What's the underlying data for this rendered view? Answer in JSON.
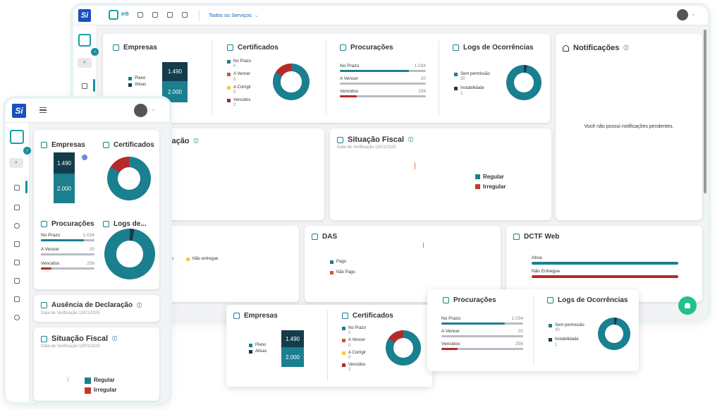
{
  "brand": {
    "logo_text": "Si",
    "secondary_logo_text": "Iri5"
  },
  "header": {
    "services_dropdown": "Todos os Serviços"
  },
  "empresas": {
    "title": "Empresas",
    "legend": [
      "Plano",
      "Ativas"
    ],
    "plano_value": "1.490",
    "ativas_value": "2.000"
  },
  "certificados": {
    "title": "Certificados",
    "legend": [
      {
        "label": "No Prazo",
        "count": "0",
        "color": "#1a7f8f"
      },
      {
        "label": "A Vencer",
        "count": "0",
        "color": "#d2592e"
      },
      {
        "label": "A Corrigir",
        "count": "0",
        "color": "#f2c94c"
      },
      {
        "label": "Vencidos",
        "count": "2",
        "color": "#a52a2a"
      }
    ]
  },
  "procuracoes": {
    "title": "Procurações",
    "rows": [
      {
        "label": "No Prazo",
        "value": "1.034",
        "fill": 0.8,
        "color": "#1a7f8f"
      },
      {
        "label": "A Vencer",
        "value": "20",
        "fill": 0.0,
        "color": "#1a7f8f"
      },
      {
        "label": "Vencidos",
        "value": "256",
        "fill": 0.2,
        "color": "#b52a2a"
      }
    ]
  },
  "logs": {
    "title": "Logs de Ocorrências",
    "title_short": "Logs de...",
    "legend": [
      {
        "label": "Sem permissão",
        "count": "30"
      },
      {
        "label": "Instabilidade",
        "count": "1"
      }
    ]
  },
  "notificacoes": {
    "title": "Notificações",
    "empty": "Você não possui notificações pendentes."
  },
  "ausencia": {
    "title": "Ausência de Declaração",
    "title_partial": "laração",
    "date": "Data de Verificação 13/01/2025"
  },
  "situacao": {
    "title": "Situação Fiscal",
    "date": "Data de Verificação 13/01/2025",
    "legend": [
      "Regular",
      "Irregular"
    ]
  },
  "dctf_row": {
    "left_partial": "mitido",
    "left_nao_entregue": "Não entregue"
  },
  "das": {
    "title": "DAS",
    "legend": [
      "Pago",
      "Não Pago"
    ]
  },
  "dctf_web": {
    "title": "DCTF Web",
    "rows": [
      "Ativa",
      "Não Entregue"
    ]
  },
  "colors": {
    "teal": "#1a7f8f",
    "dark": "#143c4b",
    "red": "#b52a2a",
    "accent": "#1a8ea0"
  }
}
